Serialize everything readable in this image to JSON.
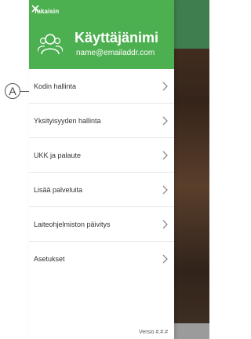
{
  "drawer": {
    "back_label": "Takaisin",
    "back_label_visible": "Takaisin",
    "username": "Käyttäjänimi",
    "email": "name@emailaddr.com",
    "header_color": "#4caf50"
  },
  "callout": {
    "label": "A"
  },
  "menu": {
    "items": [
      {
        "label": "Kodin hallinta"
      },
      {
        "label": "Yksityisyyden hallinta"
      },
      {
        "label": "UKK ja palaute"
      },
      {
        "label": "Lisää palveluita"
      },
      {
        "label": "Laiteohjelmiston päivitys"
      },
      {
        "label": "Asetukset"
      }
    ]
  },
  "footer": {
    "version": "Versio #.#.#"
  }
}
